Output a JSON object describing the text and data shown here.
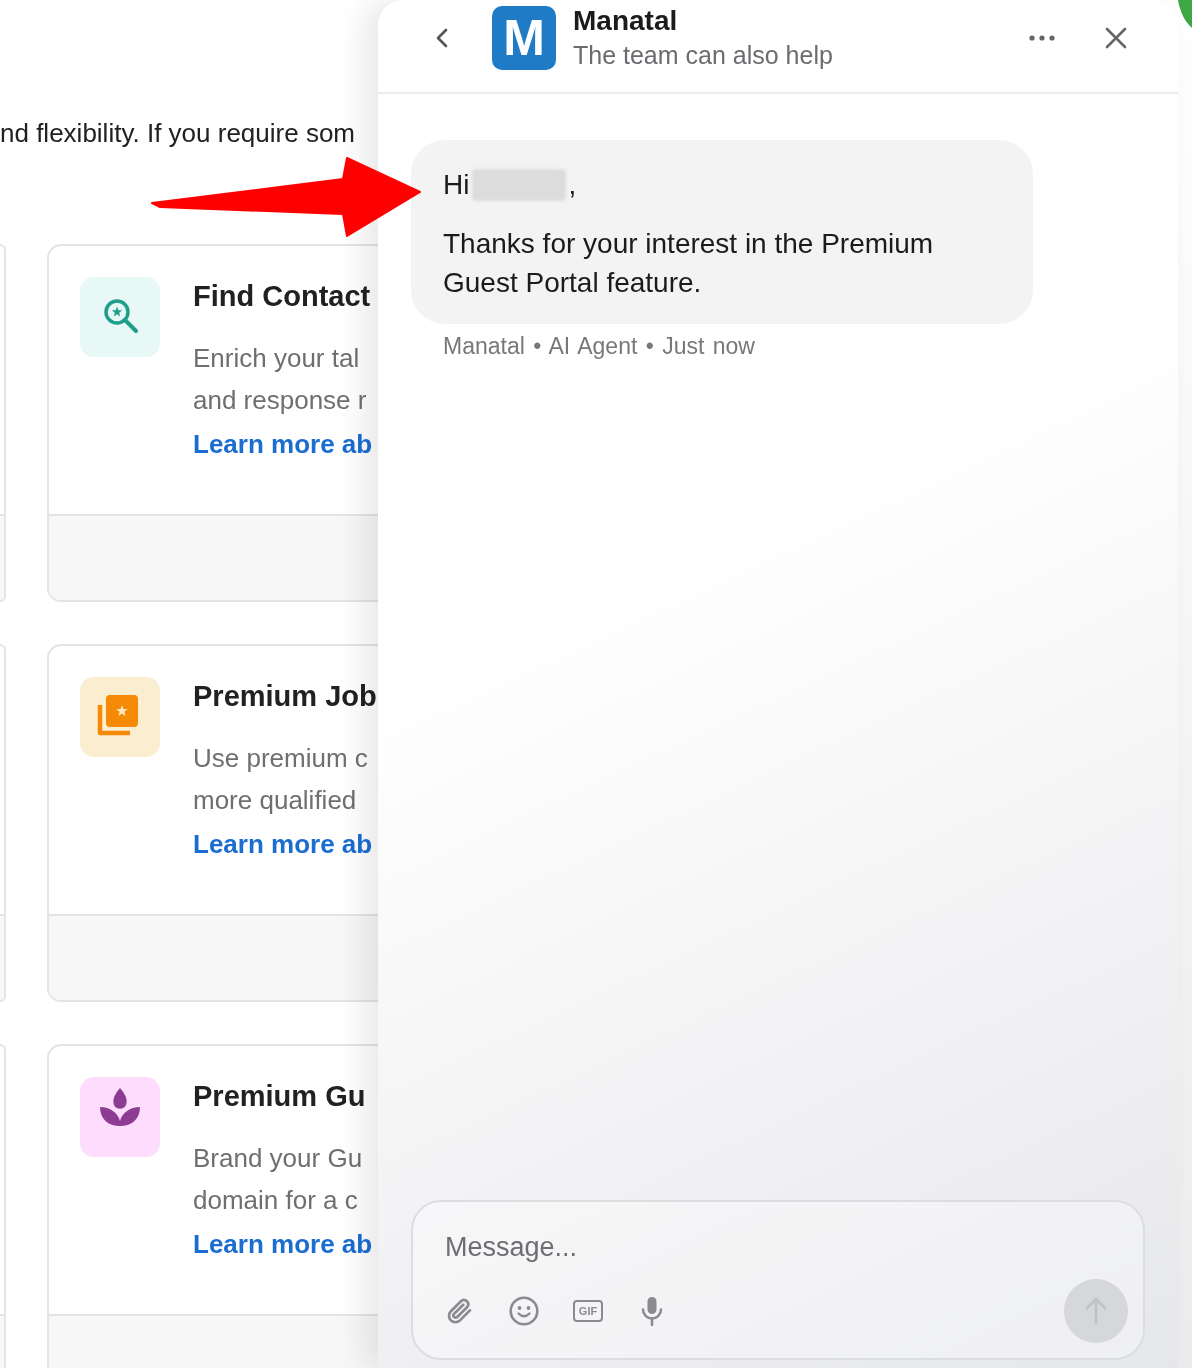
{
  "background_page": {
    "intro_text": "nd flexibility. If you require som",
    "cards": [
      {
        "title": "Find Contact",
        "description_lines": [
          "Enrich your tal",
          "and response r"
        ],
        "link": "Learn more ab"
      },
      {
        "title": "Premium Job",
        "description_lines": [
          "Use premium c",
          "more qualified"
        ],
        "link": "Learn more ab"
      },
      {
        "title": "Premium Gu",
        "description_lines": [
          "Brand your Gu",
          "domain for a c"
        ],
        "link": "Learn more ab"
      }
    ]
  },
  "chat": {
    "header": {
      "logo_letter": "M",
      "title": "Manatal",
      "subtitle": "The team can also help"
    },
    "messages": [
      {
        "greeting": "Hi",
        "name_redacted": true,
        "greeting_end": ",",
        "body": "Thanks for your interest in the Premium Guest Portal feature.",
        "meta": "Manatal • AI Agent • Just now"
      }
    ],
    "composer": {
      "placeholder": "Message...",
      "gif_label": "GIF",
      "send_button": {
        "disabled": true
      }
    }
  }
}
